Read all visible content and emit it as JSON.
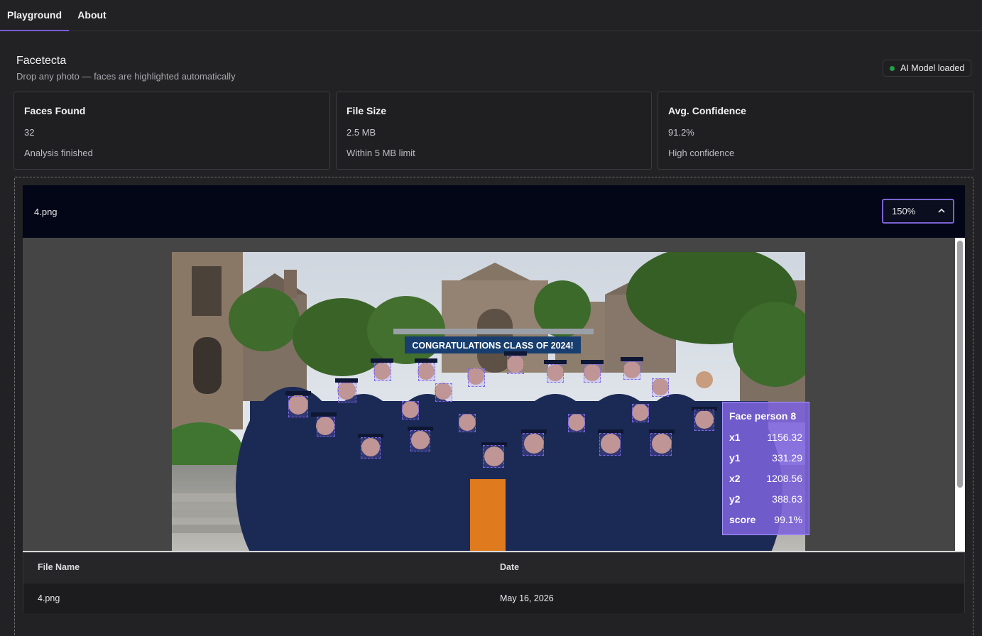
{
  "tabs": [
    {
      "label": "Playground",
      "active": true
    },
    {
      "label": "About",
      "active": false
    }
  ],
  "header": {
    "title": "Facetecta",
    "subtitle": "Drop any photo — faces are highlighted automatically"
  },
  "status": {
    "label": "AI Model loaded",
    "color": "#22a045"
  },
  "cards": [
    {
      "title": "Faces Found",
      "value": "32",
      "note": "Analysis finished"
    },
    {
      "title": "File Size",
      "value": "2.5 MB",
      "note": "Within 5 MB limit"
    },
    {
      "title": "Avg. Confidence",
      "value": "91.2%",
      "note": "High confidence"
    }
  ],
  "viewer": {
    "file_name": "4.png",
    "zoom": "150%",
    "photo_banner": "CONGRATULATIONS CLASS OF 2024!"
  },
  "tooltip": {
    "title": "Face person 8",
    "rows": [
      {
        "key": "x1",
        "value": "1156.32"
      },
      {
        "key": "y1",
        "value": "331.29"
      },
      {
        "key": "x2",
        "value": "1208.56"
      },
      {
        "key": "y2",
        "value": "388.63"
      },
      {
        "key": "score",
        "value": "99.1%"
      }
    ]
  },
  "table": {
    "headers": [
      "File Name",
      "Date"
    ],
    "rows": [
      [
        "4.png",
        "May 16, 2026"
      ]
    ]
  },
  "colors": {
    "accent": "#7c5cd6",
    "face_box": "#7e67ea"
  },
  "icons": {
    "status": "dot-icon",
    "zoom": "chevron-up-icon"
  }
}
